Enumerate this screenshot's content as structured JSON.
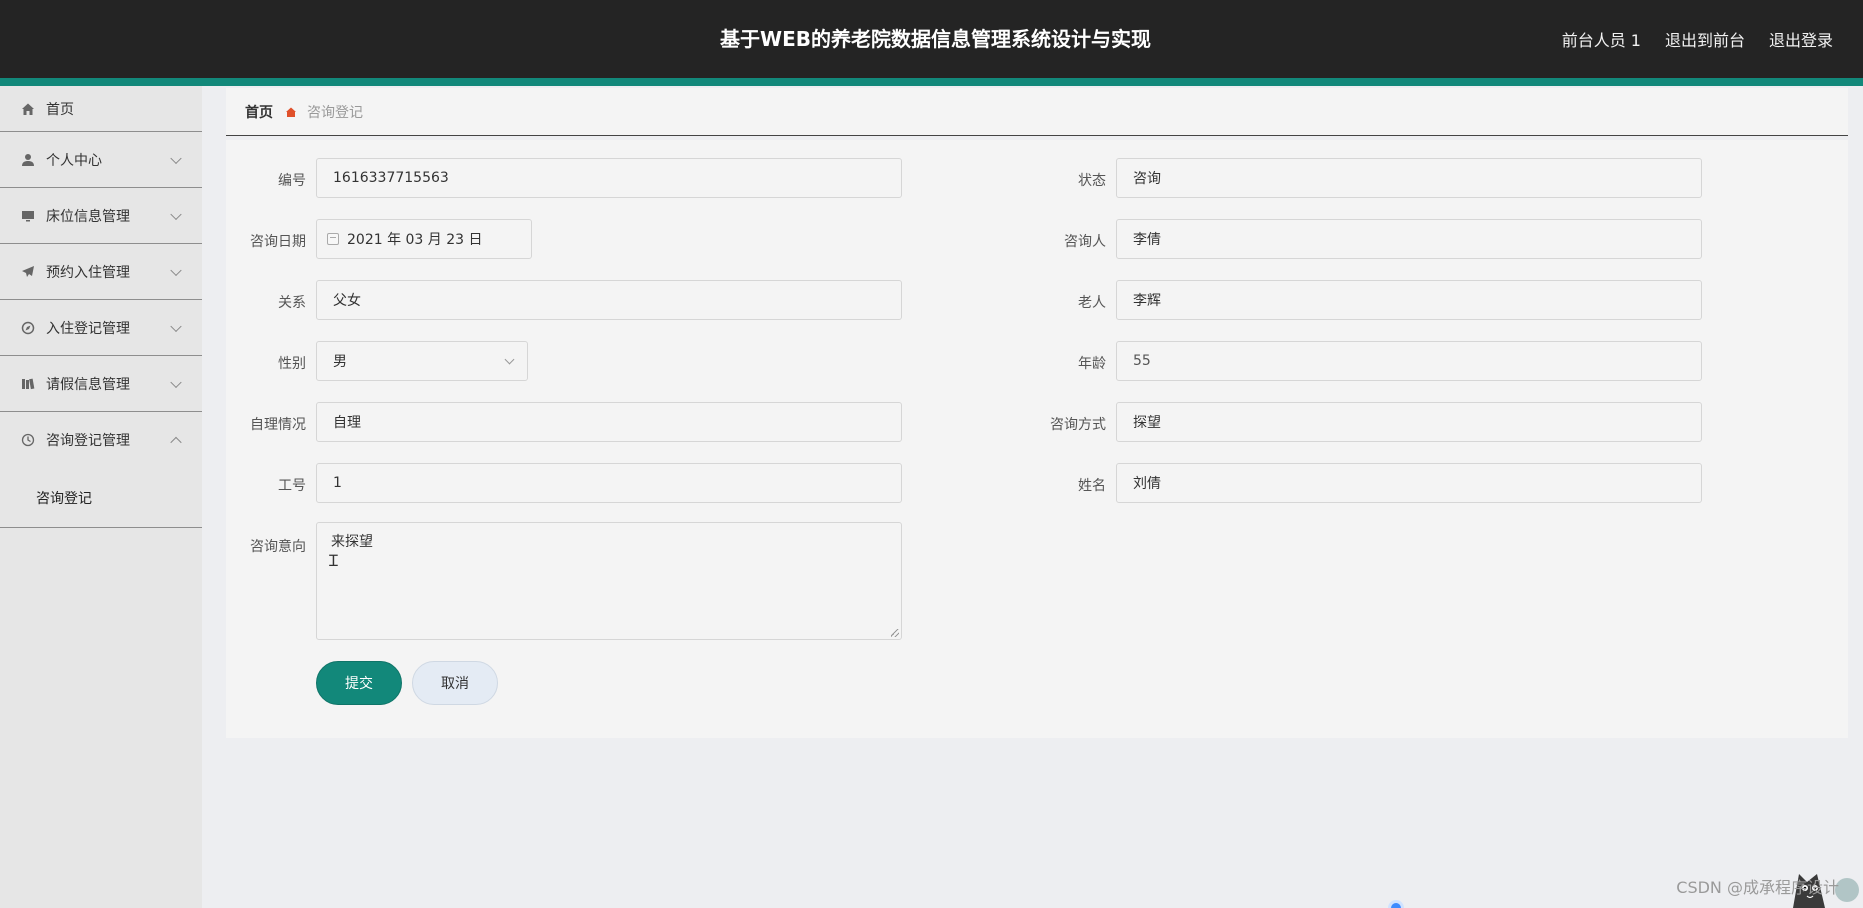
{
  "header": {
    "title": "基于WEB的养老院数据信息管理系统设计与实现",
    "user": "前台人员 1",
    "to_front": "退出到前台",
    "logout": "退出登录"
  },
  "sidebar": {
    "items": [
      {
        "label": "首页",
        "icon": "home-icon"
      },
      {
        "label": "个人中心",
        "icon": "user-icon"
      },
      {
        "label": "床位信息管理",
        "icon": "monitor-icon"
      },
      {
        "label": "预约入住管理",
        "icon": "paper-plane-icon"
      },
      {
        "label": "入住登记管理",
        "icon": "compass-icon"
      },
      {
        "label": "请假信息管理",
        "icon": "books-icon"
      },
      {
        "label": "咨询登记管理",
        "icon": "clock-icon"
      }
    ],
    "sub_item": "咨询登记"
  },
  "breadcrumb": {
    "home": "首页",
    "current": "咨询登记"
  },
  "form": {
    "labels": {
      "no": "编号",
      "status": "状态",
      "date": "咨询日期",
      "consultant": "咨询人",
      "relation": "关系",
      "elder": "老人",
      "gender": "性别",
      "age": "年龄",
      "self_care": "自理情况",
      "method": "咨询方式",
      "staff_no": "工号",
      "name": "姓名",
      "intention": "咨询意向"
    },
    "values": {
      "no": "1616337715563",
      "status": "咨询",
      "date": "2021 年 03 月 23 日",
      "consultant": "李倩",
      "relation": "父女",
      "elder": "李辉",
      "gender": "男",
      "age": "55",
      "self_care": "自理",
      "method": "探望",
      "staff_no": "1",
      "name": "刘倩",
      "intention": "来探望"
    },
    "submit": "提交",
    "cancel": "取消"
  },
  "watermark": "CSDN @成承程序设计"
}
